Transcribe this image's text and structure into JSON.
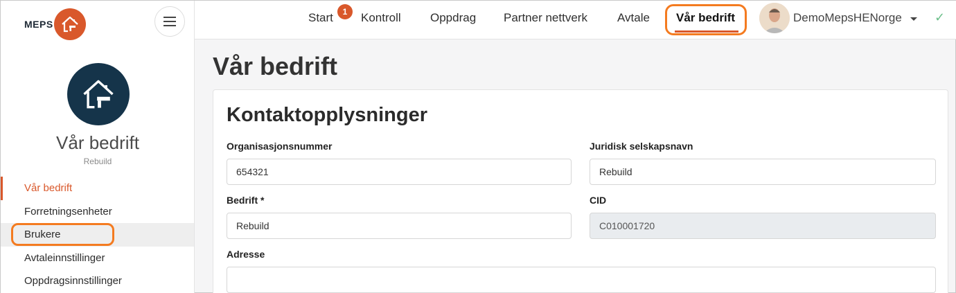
{
  "brand": {
    "logo_text": "MEPS"
  },
  "sidebar": {
    "company_name": "Vår bedrift",
    "company_sub": "Rebuild",
    "items": [
      {
        "label": "Vår bedrift",
        "active": true
      },
      {
        "label": "Forretningsenheter"
      },
      {
        "label": "Brukere",
        "highlighted": true
      },
      {
        "label": "Avtaleinnstillinger"
      },
      {
        "label": "Oppdragsinnstillinger"
      }
    ]
  },
  "topnav": {
    "items": [
      {
        "label": "Start",
        "badge": "1"
      },
      {
        "label": "Kontroll"
      },
      {
        "label": "Oppdrag"
      },
      {
        "label": "Partner nettverk"
      },
      {
        "label": "Avtale"
      },
      {
        "label": "Vår bedrift",
        "active": true
      }
    ],
    "user": "DemoMepsHENorge",
    "status_icon": "check-icon"
  },
  "page": {
    "title": "Vår bedrift"
  },
  "contact": {
    "title": "Kontaktopplysninger",
    "fields": {
      "org_number": {
        "label": "Organisasjonsnummer",
        "value": "654321"
      },
      "legal_name": {
        "label": "Juridisk selskapsnavn",
        "value": "Rebuild"
      },
      "company": {
        "label": "Bedrift *",
        "value": "Rebuild"
      },
      "cid": {
        "label": "CID",
        "value": "C010001720"
      },
      "address": {
        "label": "Adresse",
        "value": ""
      }
    }
  },
  "colors": {
    "accent": "#d9582b",
    "highlight": "#f47b20",
    "avatar_bg": "#15344a"
  }
}
